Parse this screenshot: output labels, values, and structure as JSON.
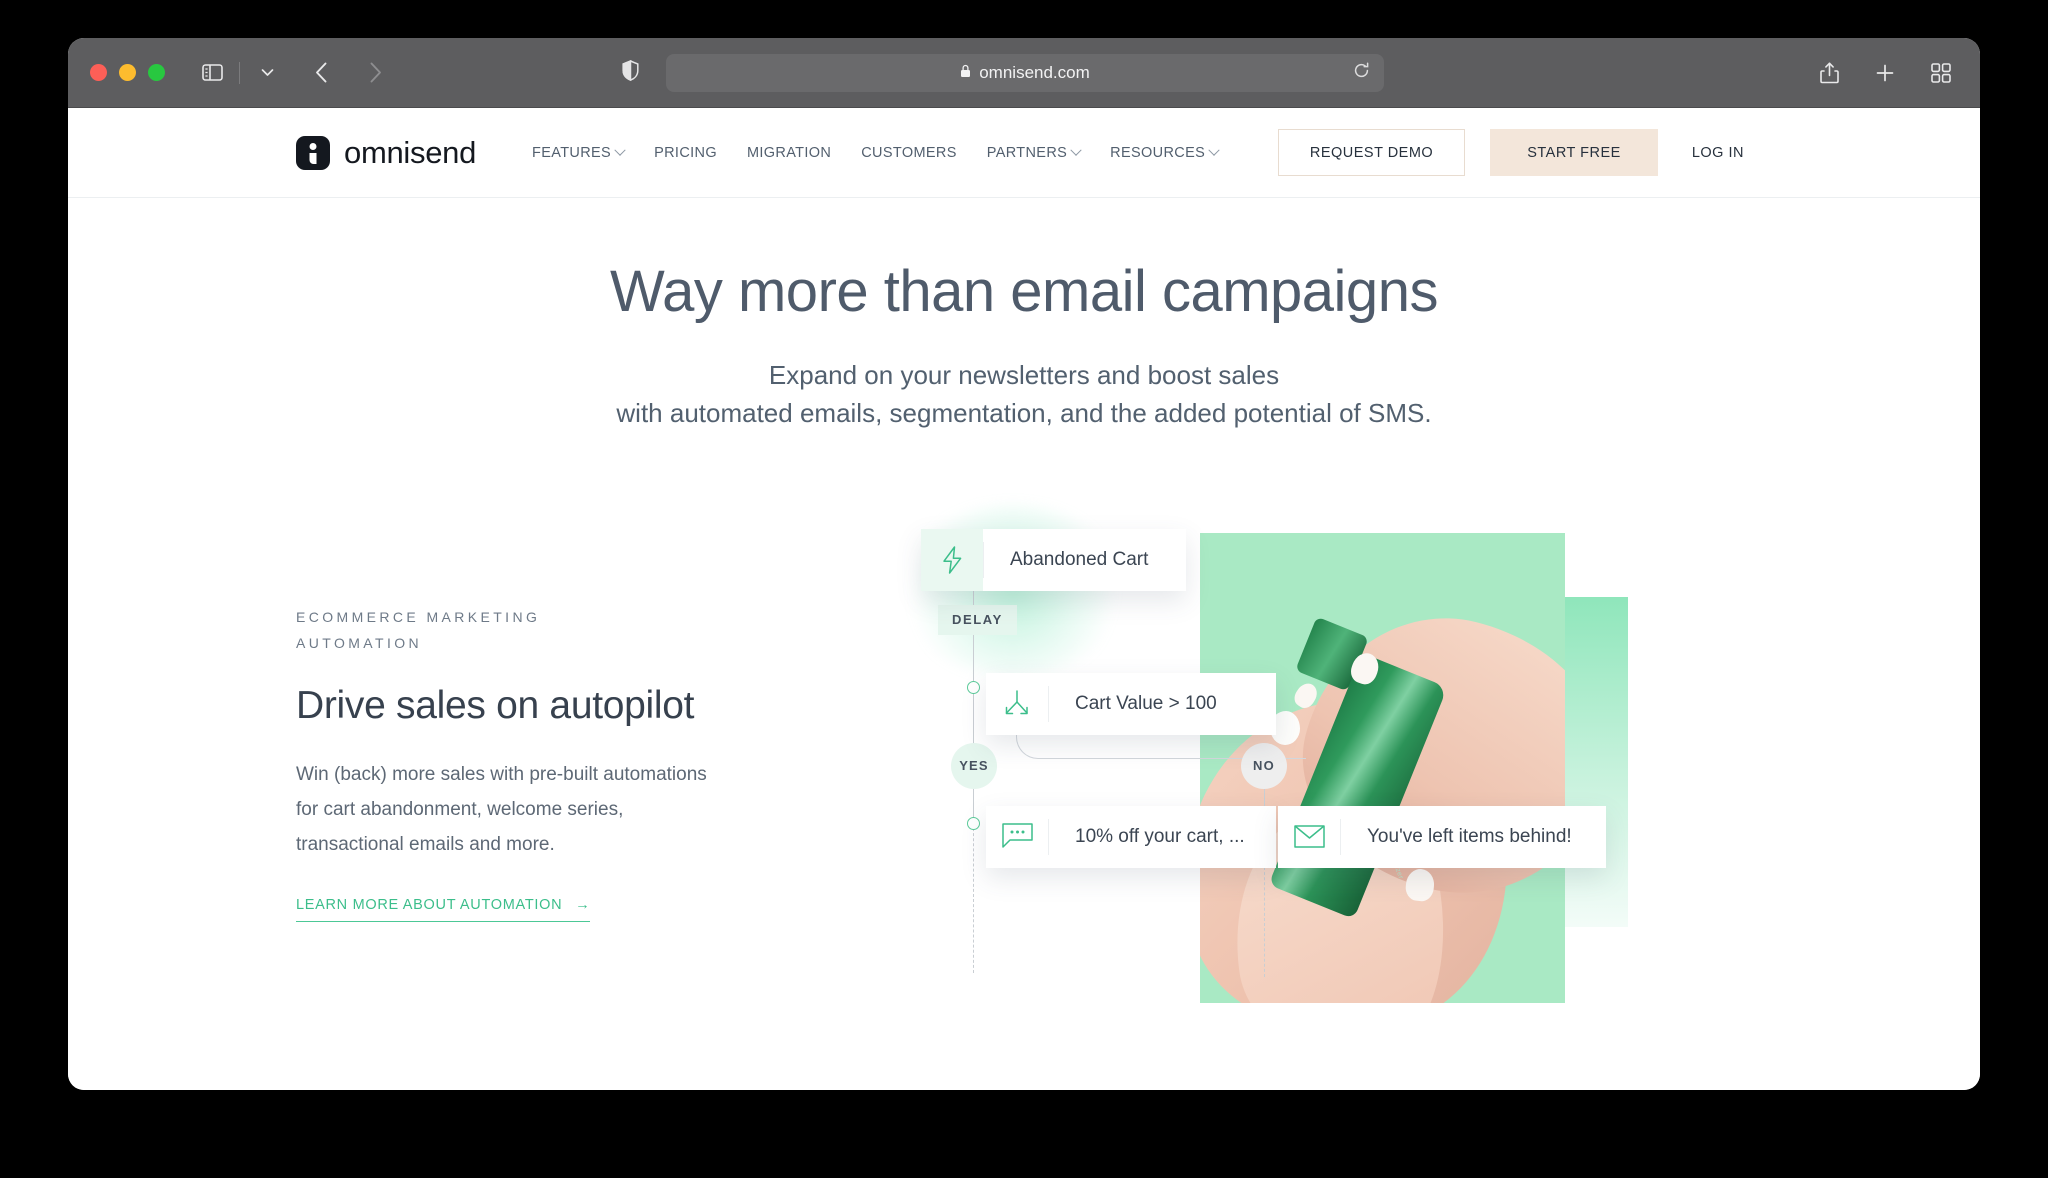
{
  "browser": {
    "url": "omnisend.com",
    "lock_icon": "lock-icon",
    "shield_icon": "shield-icon",
    "reload_icon": "reload-icon",
    "back_icon": "back-arrow-icon",
    "forward_icon": "forward-arrow-icon",
    "sidebar_icon": "sidebar-toggle-icon",
    "tab_overview_dropdown_icon": "chevron-down-icon",
    "share_icon": "share-icon",
    "new_tab_icon": "plus-icon",
    "tabs_icon": "tab-grid-icon",
    "traffic_lights": [
      "close",
      "minimize",
      "zoom"
    ]
  },
  "site_header": {
    "brand": "omnisend",
    "nav": [
      {
        "label": "FEATURES",
        "has_dropdown": true
      },
      {
        "label": "PRICING",
        "has_dropdown": false
      },
      {
        "label": "MIGRATION",
        "has_dropdown": false
      },
      {
        "label": "CUSTOMERS",
        "has_dropdown": false
      },
      {
        "label": "PARTNERS",
        "has_dropdown": true
      },
      {
        "label": "RESOURCES",
        "has_dropdown": true
      }
    ],
    "request_demo": "REQUEST DEMO",
    "start_free": "START FREE",
    "log_in": "LOG IN"
  },
  "hero": {
    "title": "Way more than email campaigns",
    "subtitle_line1": "Expand on your newsletters and boost sales",
    "subtitle_line2": "with automated emails, segmentation, and the added potential of SMS."
  },
  "feature": {
    "eyebrow": "ECOMMERCE MARKETING AUTOMATION",
    "title": "Drive sales on autopilot",
    "body_line1": "Win (back) more sales with pre-built automations",
    "body_line2": "for cart abandonment, welcome series,",
    "body_line3": "transactional emails and more.",
    "link_label": "LEARN MORE ABOUT AUTOMATION",
    "link_arrow": "→"
  },
  "workflow": {
    "trigger": {
      "label": "Abandoned Cart",
      "icon": "lightning-bolt-icon"
    },
    "delay_badge": "DELAY",
    "condition": {
      "label": "Cart Value > 100",
      "icon": "split-branch-icon"
    },
    "yes_badge": "YES",
    "no_badge": "NO",
    "yes_action": {
      "label": "10% off your cart, ...",
      "icon": "sms-bubble-icon"
    },
    "no_action": {
      "label": "You've left items behind!",
      "icon": "email-envelope-icon"
    },
    "photo_product_label": "the moisturizer"
  },
  "colors": {
    "accent_green": "#3cbe8b",
    "mint": "#a9e9c4",
    "cream": "#f3e6da",
    "text_dark": "#37414e",
    "text_muted": "#5d6875"
  }
}
